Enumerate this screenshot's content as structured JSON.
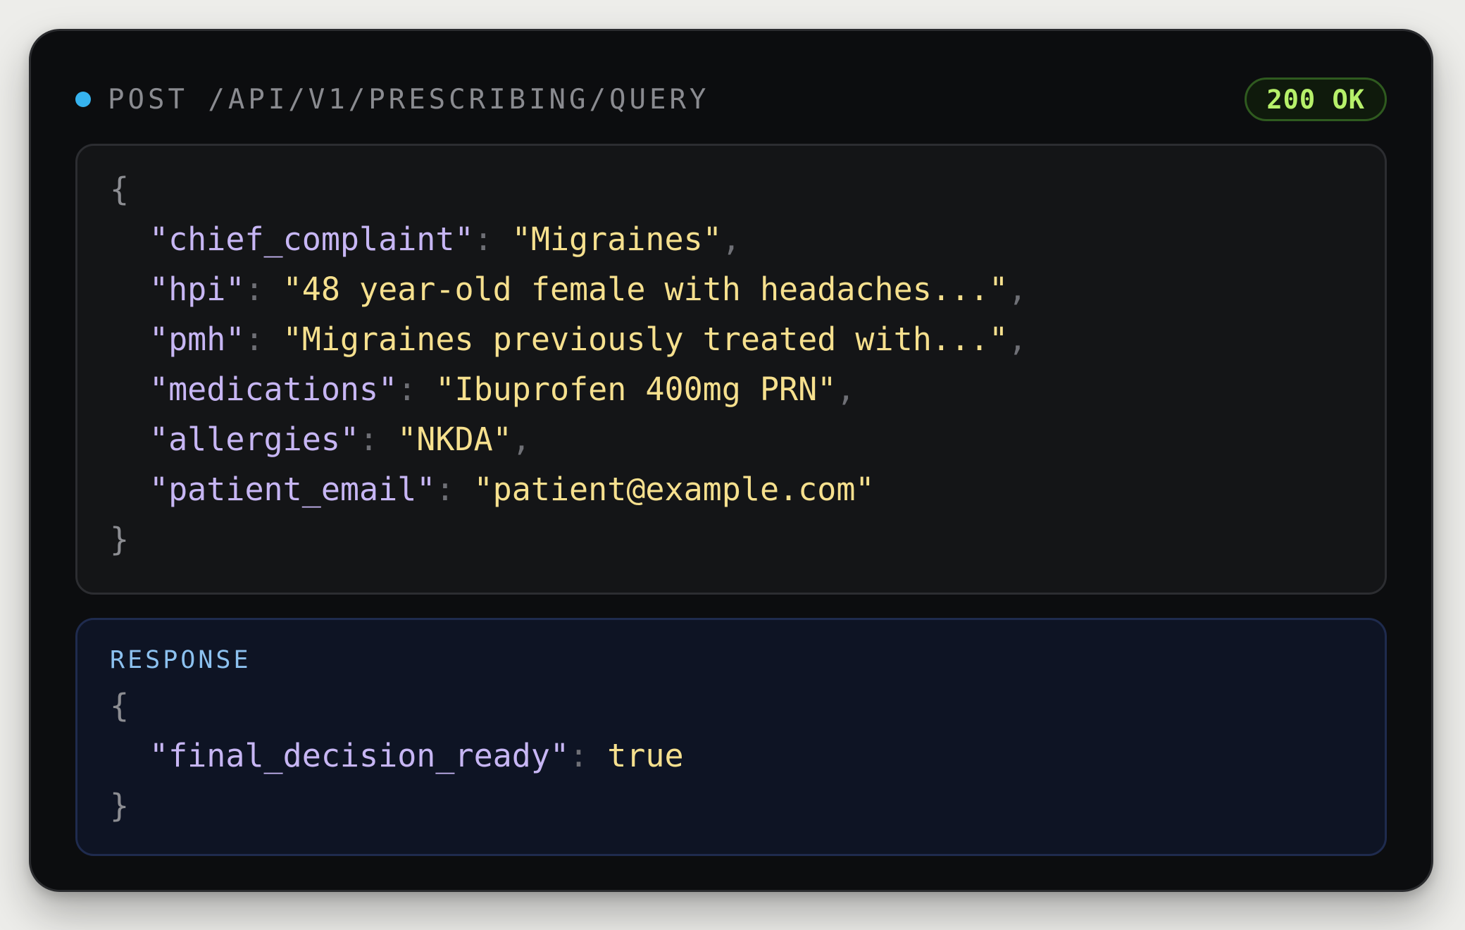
{
  "header": {
    "endpoint": "POST /API/V1/PRESCRIBING/QUERY",
    "status": "200 OK",
    "dot_color": "#36b3ef"
  },
  "request": {
    "open_brace": "{",
    "close_brace": "}",
    "fields": [
      {
        "key": "\"chief_complaint\"",
        "value": "\"Migraines\"",
        "comma": ","
      },
      {
        "key": "\"hpi\"",
        "value": "\"48 year-old female with headaches...\"",
        "comma": ","
      },
      {
        "key": "\"pmh\"",
        "value": "\"Migraines previously treated with...\"",
        "comma": ","
      },
      {
        "key": "\"medications\"",
        "value": "\"Ibuprofen 400mg PRN\"",
        "comma": ","
      },
      {
        "key": "\"allergies\"",
        "value": "\"NKDA\"",
        "comma": ","
      },
      {
        "key": "\"patient_email\"",
        "value": "\"patient@example.com\"",
        "comma": ""
      }
    ]
  },
  "response": {
    "label": "RESPONSE",
    "open_brace": "{",
    "close_brace": "}",
    "fields": [
      {
        "key": "\"final_decision_ready\"",
        "value": "true",
        "comma": ""
      }
    ]
  },
  "colors": {
    "key": "#c7b6f4",
    "string": "#f6e08e",
    "status_text": "#b6f06a",
    "status_border": "#2f5a1f"
  }
}
